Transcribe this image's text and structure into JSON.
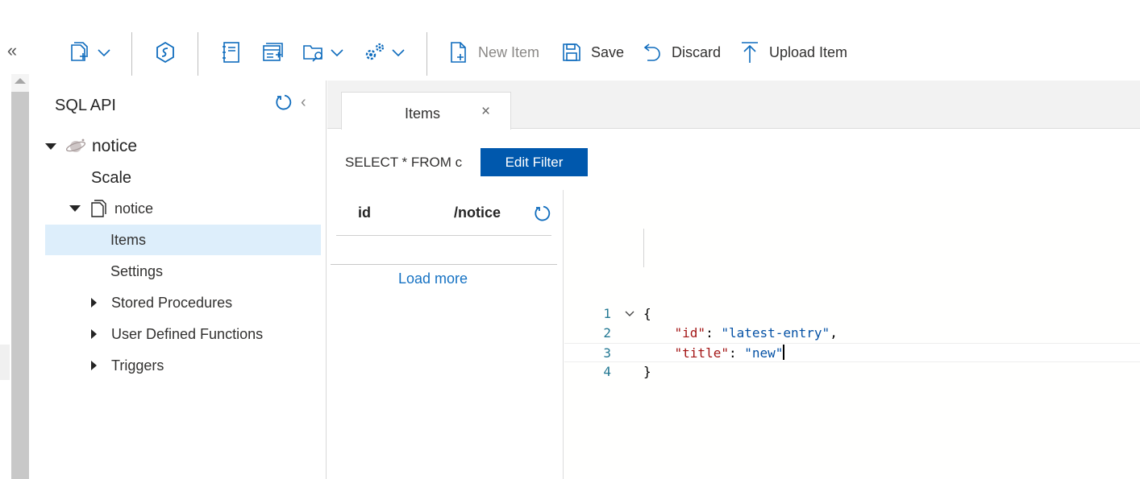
{
  "toolbar": {
    "collapse_glyph": "«",
    "new_item_label": "New Item",
    "save_label": "Save",
    "discard_label": "Discard",
    "upload_label": "Upload Item",
    "icons": [
      "new-container-icon",
      "synapse-link-icon",
      "notebook-icon",
      "new-sql-query-icon",
      "open-query-icon",
      "settings-gears-icon"
    ]
  },
  "tree": {
    "title": "SQL API",
    "database": "notice",
    "scale": "Scale",
    "container": "notice",
    "items": "Items",
    "settings": "Settings",
    "stored_procedures": "Stored Procedures",
    "udfs": "User Defined Functions",
    "triggers": "Triggers"
  },
  "tabs": [
    {
      "label": "Items",
      "close": "×"
    }
  ],
  "query": {
    "text": "SELECT * FROM c",
    "edit_filter_label": "Edit Filter"
  },
  "list": {
    "col_id": "id",
    "col_partition": "/notice",
    "load_more": "Load more"
  },
  "editor": {
    "lines": [
      {
        "n": "1",
        "text": "{"
      },
      {
        "n": "2",
        "key": "\"id\"",
        "value": "\"latest-entry\"",
        "trail": ","
      },
      {
        "n": "3",
        "key": "\"title\"",
        "value": "\"new\"",
        "trail": ""
      },
      {
        "n": "4",
        "text": "}"
      }
    ]
  },
  "colors": {
    "accent": "#0058ad",
    "selected_row": "#ddeefb",
    "link": "#1672c3",
    "json_key": "#a31515",
    "json_string": "#0451a5",
    "line_number": "#237893"
  }
}
